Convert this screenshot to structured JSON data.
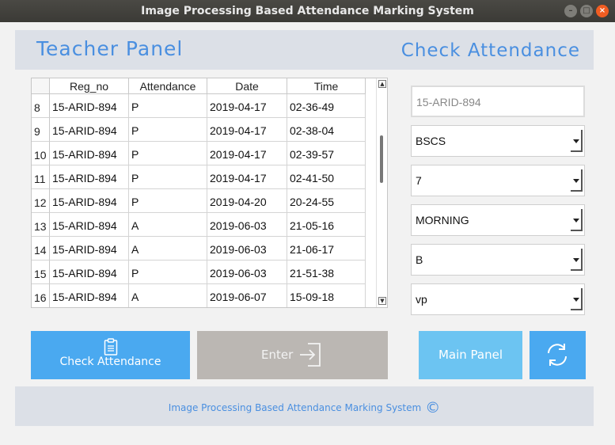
{
  "window": {
    "title": "Image Processing Based Attendance Marking System",
    "buttons": [
      "–",
      "□",
      "×"
    ]
  },
  "header": {
    "left_title": "Teacher Panel",
    "right_title": "Check Attendance"
  },
  "table": {
    "columns": [
      "Reg_no",
      "Attendance",
      "Date",
      "Time"
    ],
    "rows": [
      {
        "num": "8",
        "reg_no": "15-ARID-894",
        "attendance": "P",
        "date": "2019-04-17",
        "time": "02-36-49"
      },
      {
        "num": "9",
        "reg_no": "15-ARID-894",
        "attendance": "P",
        "date": "2019-04-17",
        "time": "02-38-04"
      },
      {
        "num": "10",
        "reg_no": "15-ARID-894",
        "attendance": "P",
        "date": "2019-04-17",
        "time": "02-39-57"
      },
      {
        "num": "11",
        "reg_no": "15-ARID-894",
        "attendance": "P",
        "date": "2019-04-17",
        "time": "02-41-50"
      },
      {
        "num": "12",
        "reg_no": "15-ARID-894",
        "attendance": "P",
        "date": "2019-04-20",
        "time": "20-24-55"
      },
      {
        "num": "13",
        "reg_no": "15-ARID-894",
        "attendance": "A",
        "date": "2019-06-03",
        "time": "21-05-16"
      },
      {
        "num": "14",
        "reg_no": "15-ARID-894",
        "attendance": "A",
        "date": "2019-06-03",
        "time": "21-06-17"
      },
      {
        "num": "15",
        "reg_no": "15-ARID-894",
        "attendance": "P",
        "date": "2019-06-03",
        "time": "21-51-38"
      },
      {
        "num": "16",
        "reg_no": "15-ARID-894",
        "attendance": "A",
        "date": "2019-06-07",
        "time": "15-09-18"
      }
    ]
  },
  "form": {
    "reg_no": "15-ARID-894",
    "program": "BSCS",
    "semester": "7",
    "shift": "MORNING",
    "section": "B",
    "subject": "vp"
  },
  "buttons": {
    "check_attendance": "Check Attendance",
    "enter": "Enter",
    "main_panel": "Main Panel"
  },
  "icons": {
    "check_attendance": "clipboard-icon",
    "enter": "login-arrow-icon",
    "refresh": "refresh-icon"
  },
  "footer": {
    "text": "Image Processing Based Attendance Marking System",
    "copyright": "©"
  }
}
